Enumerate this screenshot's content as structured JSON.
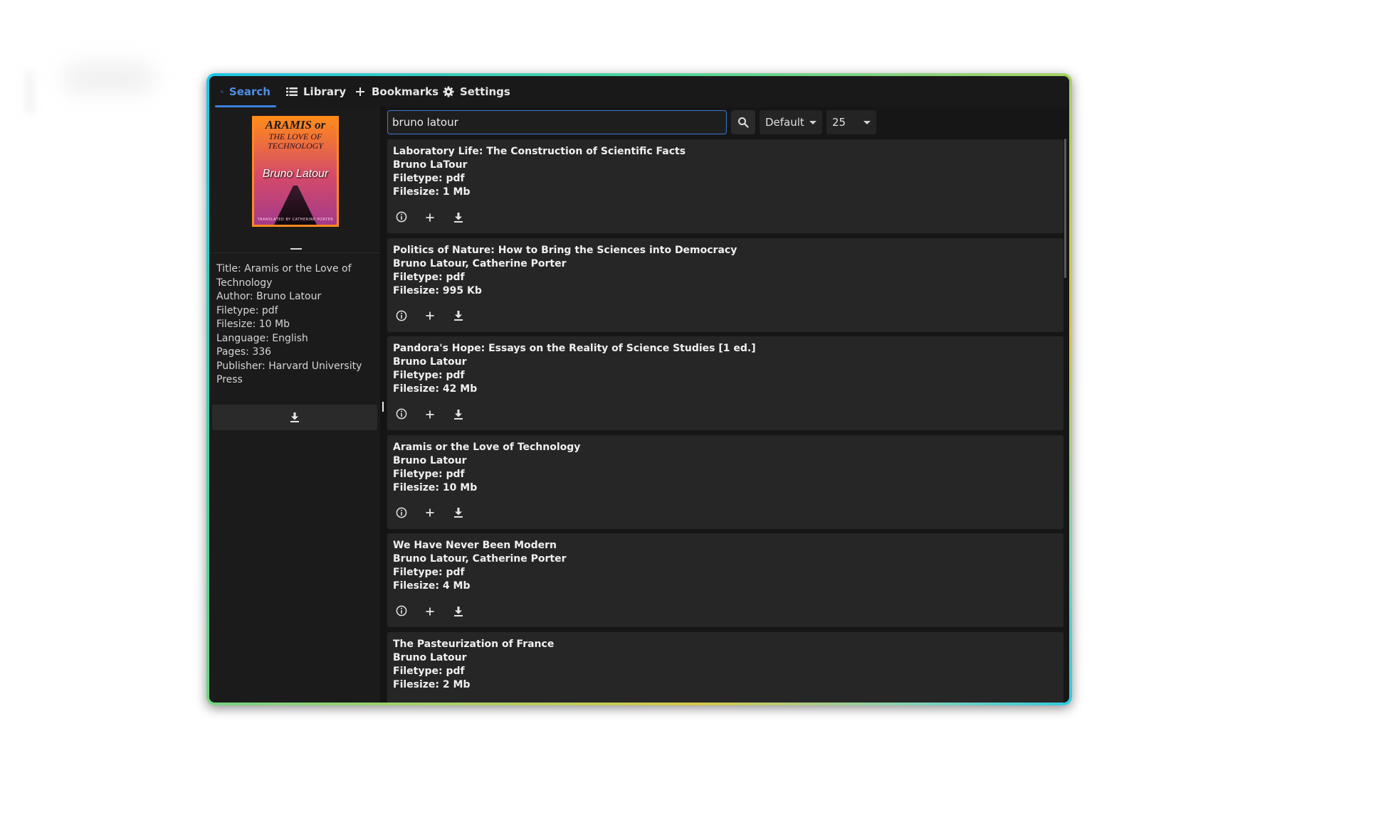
{
  "tabs": [
    {
      "label": "Search",
      "icon": "search-icon",
      "active": true
    },
    {
      "label": "Library",
      "icon": "list-icon",
      "active": false
    },
    {
      "label": "Bookmarks",
      "icon": "plus-icon",
      "active": false
    },
    {
      "label": "Settings",
      "icon": "gear-icon",
      "active": false
    }
  ],
  "colors": {
    "accent": "#3d7fe0",
    "background": "#141414",
    "card": "#262626"
  },
  "sidebar": {
    "cover": {
      "line1": "ARAMIS or",
      "line2": "THE LOVE OF TECHNOLOGY",
      "author": "Bruno Latour",
      "credit": "TRANSLATED BY CATHERINE PORTER"
    },
    "details": [
      "Title: Aramis or the Love of Technology",
      "Author: Bruno Latour",
      "Filetype: pdf",
      "Filesize: 10 Mb",
      "Language: English",
      "Pages: 336",
      "Publisher: Harvard University Press"
    ],
    "download_icon": "download-icon"
  },
  "search": {
    "value": "bruno latour",
    "sort_selected": "Default",
    "count_selected": "25"
  },
  "results": [
    {
      "title": "Laboratory Life: The Construction of Scientific Facts",
      "author": "Bruno LaTour",
      "filetype": "Filetype: pdf",
      "filesize": "Filesize: 1 Mb"
    },
    {
      "title": "Politics of Nature: How to Bring the Sciences into Democracy",
      "author": "Bruno Latour, Catherine Porter",
      "filetype": "Filetype: pdf",
      "filesize": "Filesize: 995 Kb"
    },
    {
      "title": "Pandora's Hope: Essays on the Reality of Science Studies [1 ed.]",
      "author": "Bruno Latour",
      "filetype": "Filetype: pdf",
      "filesize": "Filesize: 42 Mb"
    },
    {
      "title": "Aramis or the Love of Technology",
      "author": "Bruno Latour",
      "filetype": "Filetype: pdf",
      "filesize": "Filesize: 10 Mb"
    },
    {
      "title": "We Have Never Been Modern",
      "author": "Bruno Latour, Catherine Porter",
      "filetype": "Filetype: pdf",
      "filesize": "Filesize: 4 Mb"
    },
    {
      "title": "The Pasteurization of France",
      "author": "Bruno Latour",
      "filetype": "Filetype: pdf",
      "filesize": "Filesize: 2 Mb"
    }
  ]
}
